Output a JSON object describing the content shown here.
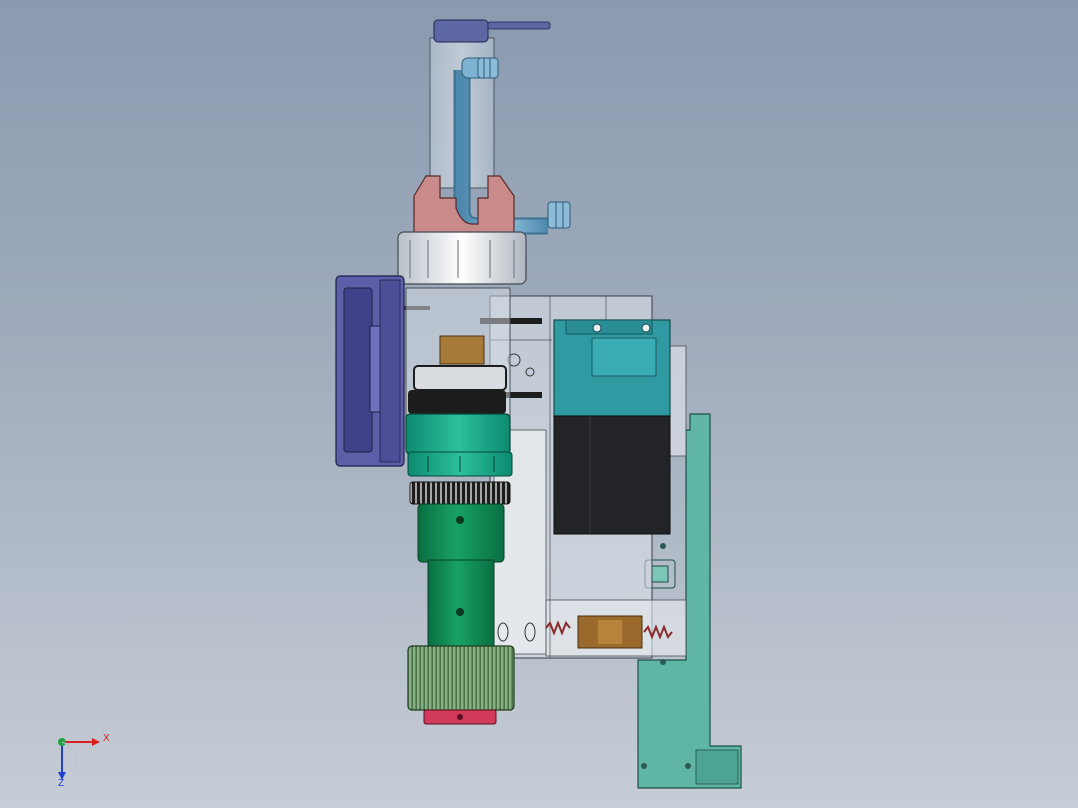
{
  "viewport": {
    "background_top": "#8a9aaf",
    "background_bottom": "#c7cdd6"
  },
  "colors": {
    "tube_blue": "#6fa6c6",
    "clamp_pink": "#c98a8a",
    "nut_white": "#e9edf1",
    "clip_purple": "#5c5fa8",
    "lens_green": "#1aa586",
    "barrel_green": "#0f8a55",
    "knob_green": "#7fb07a",
    "cap_red": "#d23a5c",
    "valve_teal": "#2f9aa2",
    "coil_black": "#222428",
    "bracket_teal": "#5fb6a4",
    "housing_glass": "#dfe4ea"
  },
  "triad": {
    "x_label": "X",
    "z_label": "Z"
  }
}
